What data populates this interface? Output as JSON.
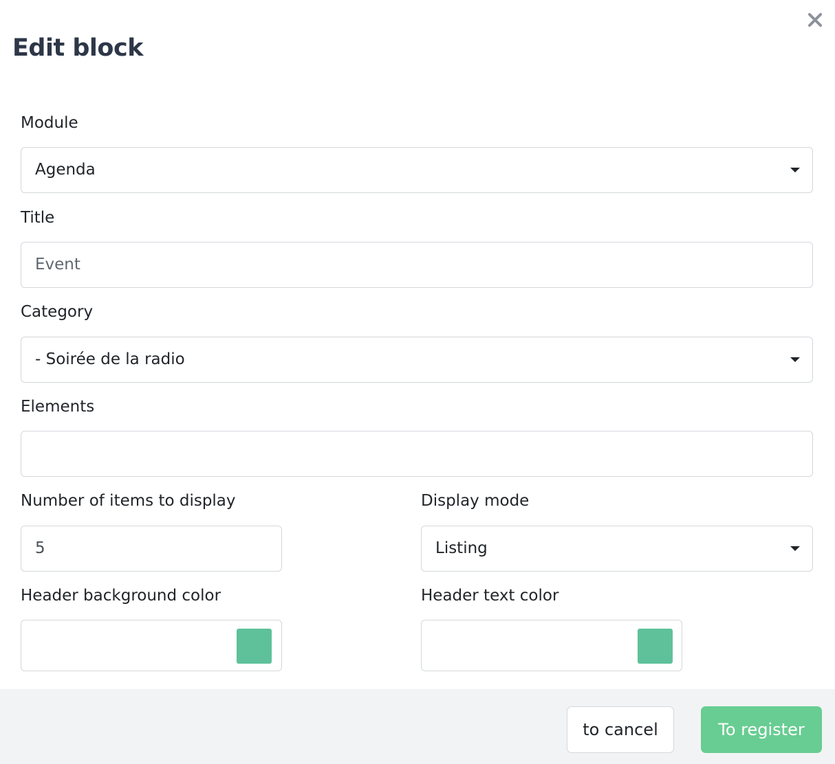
{
  "modal": {
    "title": "Edit block",
    "close_icon": "close-icon"
  },
  "form": {
    "module": {
      "label": "Module",
      "value": "Agenda"
    },
    "title": {
      "label": "Title",
      "placeholder": "Event",
      "value": ""
    },
    "category": {
      "label": "Category",
      "value": "- Soirée de la radio"
    },
    "elements": {
      "label": "Elements",
      "value": ""
    },
    "item_count": {
      "label": "Number of items to display",
      "value": "5"
    },
    "display_mode": {
      "label": "Display mode",
      "value": "Listing"
    },
    "header_bg_color": {
      "label": "Header background color",
      "color": "#5ec19a"
    },
    "header_text_color": {
      "label": "Header text color",
      "color": "#5ec19a"
    }
  },
  "footer": {
    "cancel_label": "to cancel",
    "register_label": "To register"
  },
  "colors": {
    "accent": "#68cd92",
    "swatch": "#5ec19a",
    "footer_bg": "#f2f3f5"
  }
}
